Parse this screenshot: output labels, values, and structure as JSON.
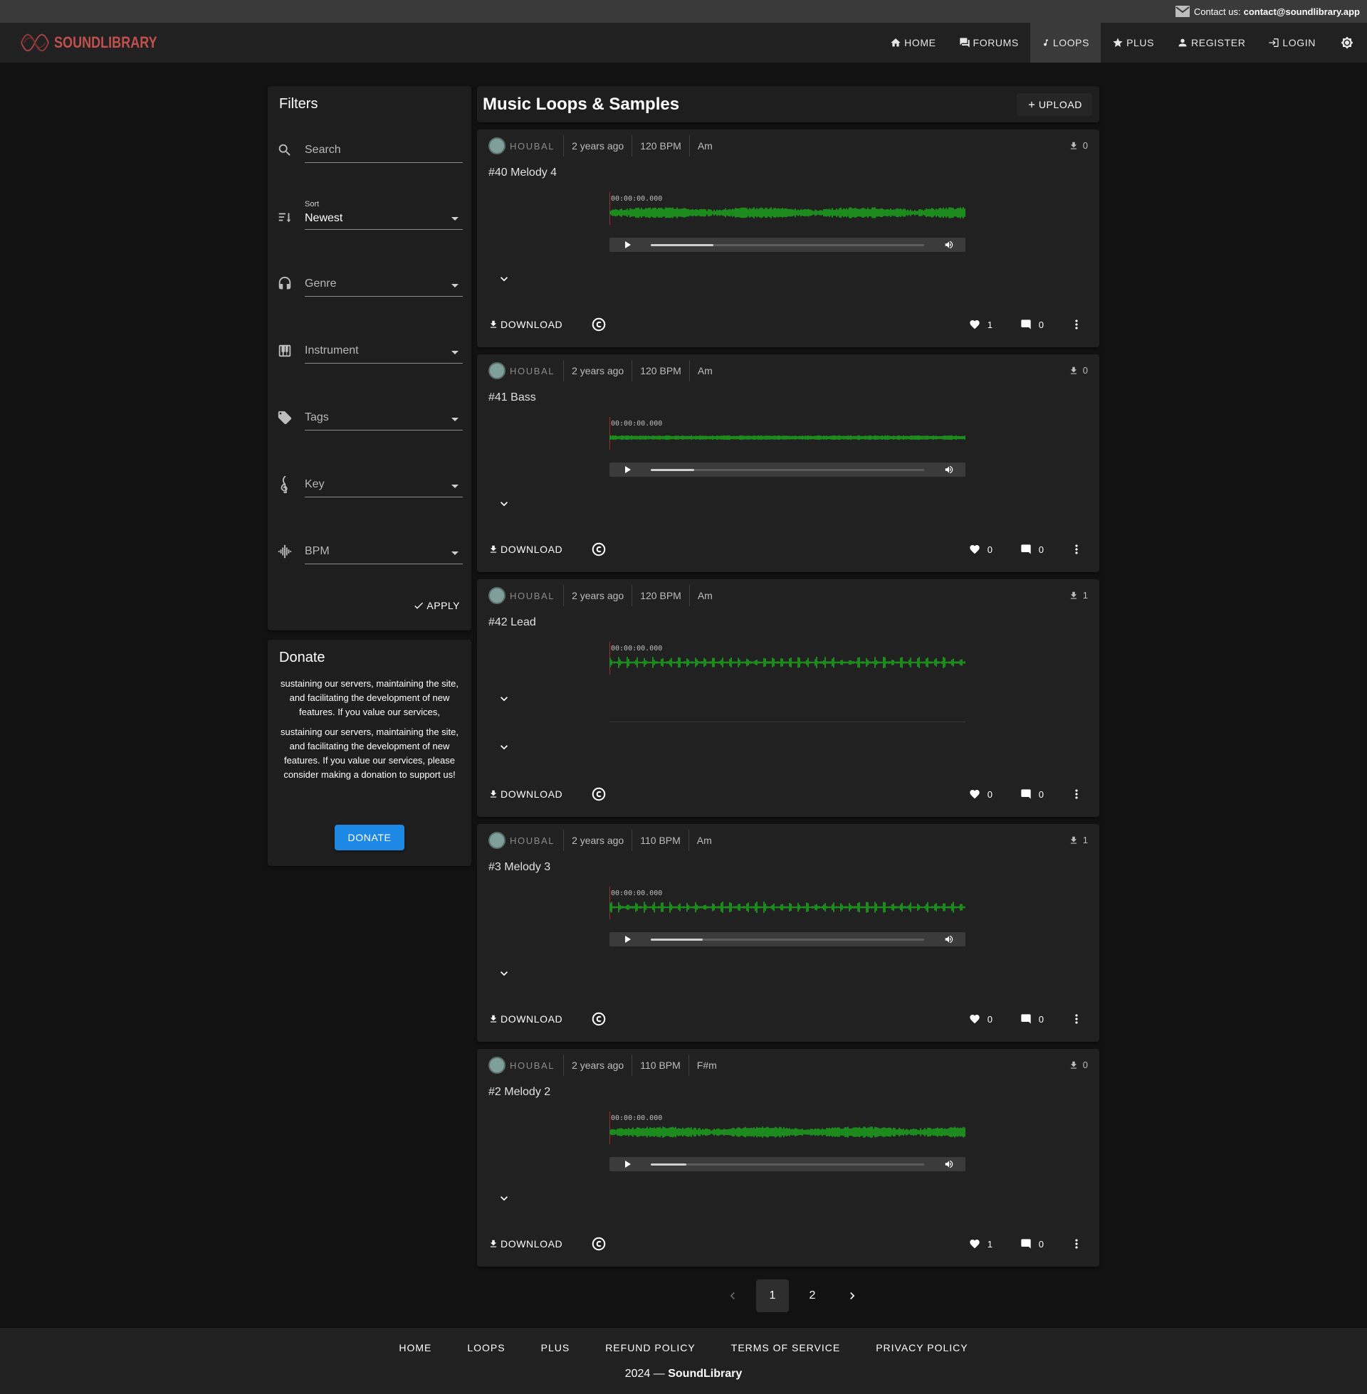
{
  "contact": {
    "prefix": "Contact us:",
    "email": "contact@soundlibrary.app",
    "icon": "mail-icon"
  },
  "brand": {
    "name": "SOUNDLIBRARY",
    "color": "#c0504d"
  },
  "nav": {
    "items": [
      {
        "label": "HOME",
        "icon": "home-icon"
      },
      {
        "label": "FORUMS",
        "icon": "forum-icon"
      },
      {
        "label": "LOOPS",
        "icon": "music-note-icon",
        "active": true
      },
      {
        "label": "PLUS",
        "icon": "star-icon"
      },
      {
        "label": "REGISTER",
        "icon": "person-icon"
      },
      {
        "label": "LOGIN",
        "icon": "login-icon"
      }
    ],
    "theme_icon": "brightness-icon"
  },
  "filters": {
    "title": "Filters",
    "search_label": "Search",
    "sort_label": "Sort",
    "sort_value": "Newest",
    "genre_label": "Genre",
    "instrument_label": "Instrument",
    "tags_label": "Tags",
    "key_label": "Key",
    "bpm_label": "BPM",
    "apply_label": "APPLY"
  },
  "donate": {
    "title": "Donate",
    "text1": "sustaining our servers, maintaining the site, and facilitating the development of new features. If you value our services,",
    "text2": "sustaining our servers, maintaining the site, and facilitating the development of new features. If you value our services, please consider making a donation to support us!",
    "button": "DONATE",
    "button_color": "#1e88e5"
  },
  "main": {
    "title": "Music Loops & Samples",
    "upload_label": "UPLOAD"
  },
  "loops": [
    {
      "author": "HOUBAL",
      "age": "2 years ago",
      "bpm": "120 BPM",
      "key": "Am",
      "downloads": "0",
      "title": "#40 Melody 4",
      "time": "00:00:00.000",
      "progress": 0.23,
      "likes": "1",
      "comments": "0",
      "download_label": "DOWNLOAD"
    },
    {
      "author": "HOUBAL",
      "age": "2 years ago",
      "bpm": "120 BPM",
      "key": "Am",
      "downloads": "0",
      "title": "#41 Bass",
      "time": "00:00:00.000",
      "progress": 0.16,
      "likes": "0",
      "comments": "0",
      "download_label": "DOWNLOAD"
    },
    {
      "author": "HOUBAL",
      "age": "2 years ago",
      "bpm": "120 BPM",
      "key": "Am",
      "downloads": "1",
      "title": "#42 Lead",
      "time": "00:00:00.000",
      "likes": "0",
      "comments": "0",
      "download_label": "DOWNLOAD"
    },
    {
      "author": "HOUBAL",
      "age": "2 years ago",
      "bpm": "110 BPM",
      "key": "Am",
      "downloads": "1",
      "title": "#3 Melody 3",
      "time": "00:00:00.000",
      "progress": 0.19,
      "likes": "0",
      "comments": "0",
      "download_label": "DOWNLOAD"
    },
    {
      "author": "HOUBAL",
      "age": "2 years ago",
      "bpm": "110 BPM",
      "key": "F#m",
      "downloads": "0",
      "title": "#2 Melody 2",
      "time": "00:00:00.000",
      "progress": 0.13,
      "likes": "1",
      "comments": "0",
      "download_label": "DOWNLOAD"
    }
  ],
  "waveform_color": "#1d8a1d",
  "pagination": {
    "pages": [
      "1",
      "2"
    ],
    "current": "1"
  },
  "footer": {
    "links": [
      "HOME",
      "LOOPS",
      "PLUS",
      "REFUND POLICY",
      "TERMS OF SERVICE",
      "PRIVACY POLICY"
    ],
    "year": "2024 —",
    "brand": "SoundLibrary"
  }
}
